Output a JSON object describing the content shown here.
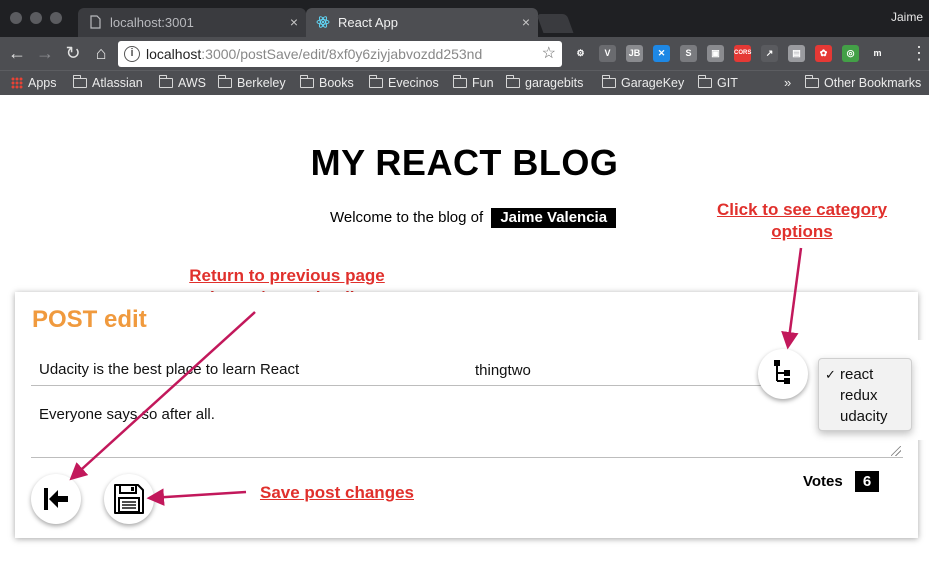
{
  "browser": {
    "tabs": [
      {
        "label": "localhost:3001",
        "close": "×"
      },
      {
        "label": "React App",
        "close": "×"
      }
    ],
    "profile_name": "Jaime",
    "url_host": "localhost",
    "url_rest": ":3000/postSave/edit/8xf0y6ziyjabvozdd253nd",
    "star_glyph": "☆",
    "extensions": [
      {
        "label": "⚙",
        "color": "#4d4e52"
      },
      {
        "label": "V",
        "color": "#6a6b6f"
      },
      {
        "label": "JB",
        "color": "#8a8b8f"
      },
      {
        "label": "✕",
        "color": "#1e88e5"
      },
      {
        "label": "S",
        "color": "#7a7b7f"
      },
      {
        "label": "▣",
        "color": "#8a8b8f"
      },
      {
        "label": "CORS",
        "color": "#e53935"
      },
      {
        "label": "↗",
        "color": "#5a5b5f"
      },
      {
        "label": "▤",
        "color": "#9a9b9f"
      },
      {
        "label": "✿",
        "color": "#e53935"
      },
      {
        "label": "◎",
        "color": "#43a047"
      },
      {
        "label": "m",
        "color": "#4d4e52"
      }
    ],
    "bookmarks": [
      "Apps",
      "Atlassian",
      "AWS",
      "Berkeley",
      "Books",
      "Evecinos",
      "Fun",
      "garagebits",
      "GarageKey",
      "GIT"
    ],
    "bookmarks_overflow": "»",
    "other_bookmarks": "Other Bookmarks"
  },
  "page": {
    "title": "MY REACT BLOG",
    "welcome_text": "Welcome to the blog of",
    "user_name": "Jaime Valencia"
  },
  "post_edit": {
    "heading": "POST edit",
    "title_value": "Udacity is the best place to learn React",
    "author_value": "thingtwo",
    "body_value": "Everyone says so after all.",
    "votes_label": "Votes",
    "votes_count": "6",
    "categories": [
      "react",
      "redux",
      "udacity"
    ],
    "selected_category": "react",
    "check_glyph": "✓"
  },
  "annotations": {
    "return": [
      "Return to previous page",
      "home / post details"
    ],
    "category": [
      "Click to see category",
      "options"
    ],
    "save": "Save post changes"
  },
  "colors": {
    "annotation": "#e0302c",
    "arrow": "#c2185b",
    "heading_accent": "#f09a3e"
  }
}
